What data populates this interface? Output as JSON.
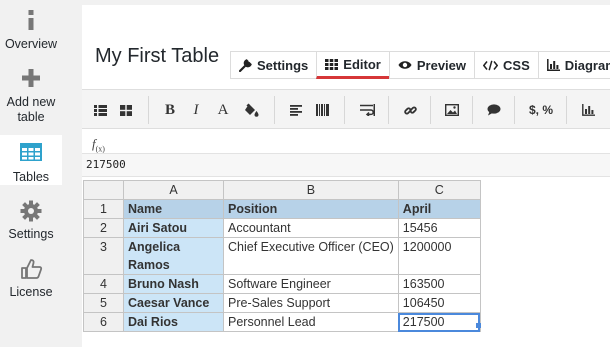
{
  "sidebar": {
    "items": [
      {
        "label": "Overview",
        "icon": "info-icon"
      },
      {
        "label": "Add new table",
        "icon": "plus-icon"
      },
      {
        "label": "Tables",
        "icon": "table-grid-icon",
        "active": true
      },
      {
        "label": "Settings",
        "icon": "gear-icon"
      },
      {
        "label": "License",
        "icon": "thumbs-up-icon"
      }
    ]
  },
  "page": {
    "title": "My First Table"
  },
  "tabs": [
    {
      "label": "Settings",
      "icon": "wrench-icon"
    },
    {
      "label": "Editor",
      "icon": "grid-icon",
      "active": true
    },
    {
      "label": "Preview",
      "icon": "eye-icon"
    },
    {
      "label": "CSS",
      "icon": "code-icon"
    },
    {
      "label": "Diagrams",
      "icon": "bar-chart-icon"
    }
  ],
  "toolbar": {
    "bold": "B",
    "italic": "I",
    "font": "A",
    "format": "$, %"
  },
  "formula": {
    "fx": "f",
    "fx_sub": "(x)",
    "value": "217500"
  },
  "grid": {
    "columns": [
      "A",
      "B",
      "C"
    ],
    "rows": [
      {
        "num": "1",
        "cells": [
          "Name",
          "Position",
          "April"
        ]
      },
      {
        "num": "2",
        "cells": [
          "Airi Satou",
          "Accountant",
          "15456"
        ]
      },
      {
        "num": "3",
        "cells": [
          "Angelica Ramos",
          "Chief Executive Officer (CEO)",
          "1200000"
        ]
      },
      {
        "num": "4",
        "cells": [
          "Bruno Nash",
          "Software Engineer",
          "163500"
        ]
      },
      {
        "num": "5",
        "cells": [
          "Caesar Vance",
          "Pre-Sales Support",
          "106450"
        ]
      },
      {
        "num": "6",
        "cells": [
          "Dai Rios",
          "Personnel Lead",
          "217500"
        ]
      }
    ]
  },
  "colors": {
    "accent_red": "#d63638",
    "header_blue": "#b7d2e8",
    "name_blue": "#cce5f7",
    "select_blue": "#4b89dc",
    "icon_teal": "#2ea2cc"
  }
}
